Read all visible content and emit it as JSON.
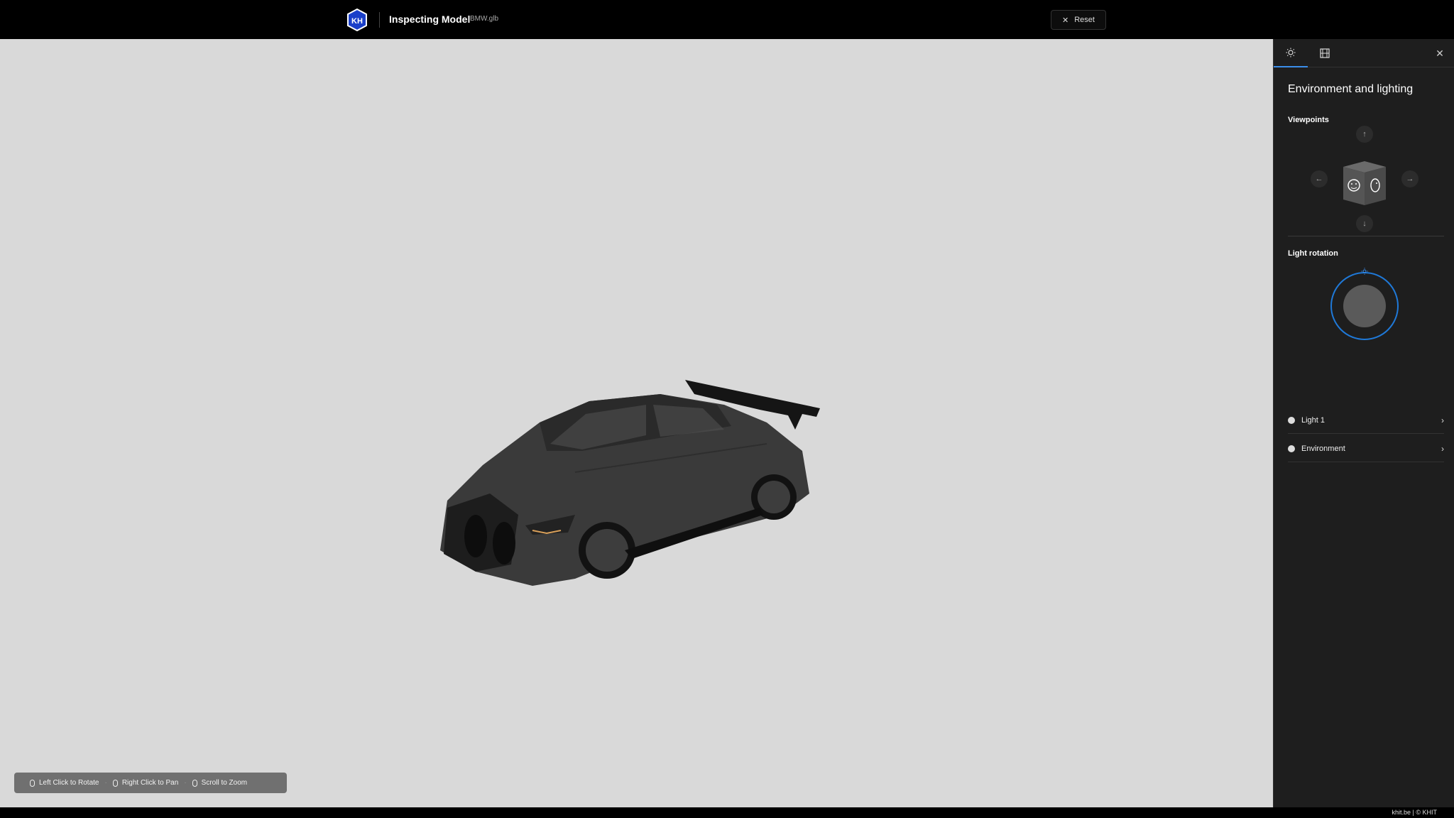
{
  "header": {
    "title": "Inspecting Model",
    "filename": "BMW.glb",
    "reset_label": "Reset"
  },
  "controls": {
    "rotate": "Left Click to Rotate",
    "pan": "Right Click to Pan",
    "zoom": "Scroll to Zoom"
  },
  "panel": {
    "tabs": [
      {
        "icon": "sun-icon",
        "active": true
      },
      {
        "icon": "film-icon",
        "active": false
      }
    ],
    "title": "Environment and lighting",
    "viewpoints_label": "Viewpoints",
    "light_rotation_label": "Light rotation",
    "items": [
      {
        "label": "Light 1"
      },
      {
        "label": "Environment"
      }
    ]
  },
  "footer": {
    "text": "khit.be | © KHIT"
  },
  "colors": {
    "accent": "#1f79d8",
    "viewport_bg": "#d9d9d9",
    "panel_bg": "#1e1e1e"
  }
}
